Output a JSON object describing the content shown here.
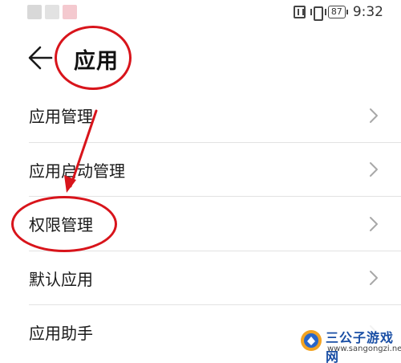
{
  "status_bar": {
    "battery": "87",
    "time": "9:32",
    "icons": [
      "nfc-icon",
      "vibrate-icon",
      "battery-icon"
    ]
  },
  "header": {
    "back_icon": "back-arrow-icon",
    "title": "应用"
  },
  "menu": {
    "items": [
      {
        "label": "应用管理",
        "icon": "chevron-right-icon"
      },
      {
        "label": "应用启动管理",
        "icon": "chevron-right-icon"
      },
      {
        "label": "权限管理",
        "icon": "chevron-right-icon"
      },
      {
        "label": "默认应用",
        "icon": "chevron-right-icon"
      },
      {
        "label": "应用助手",
        "icon": "chevron-right-icon"
      }
    ]
  },
  "annotations": {
    "color": "#d8141b",
    "highlighted_item": "权限管理"
  },
  "watermark": {
    "name": "三公子游戏网",
    "url": "www.sangongzi.net"
  },
  "colors": {
    "text": "#1a1a1a",
    "divider": "#e2e2e2",
    "chevron": "#a8a8a8",
    "annotation": "#d8141b"
  }
}
